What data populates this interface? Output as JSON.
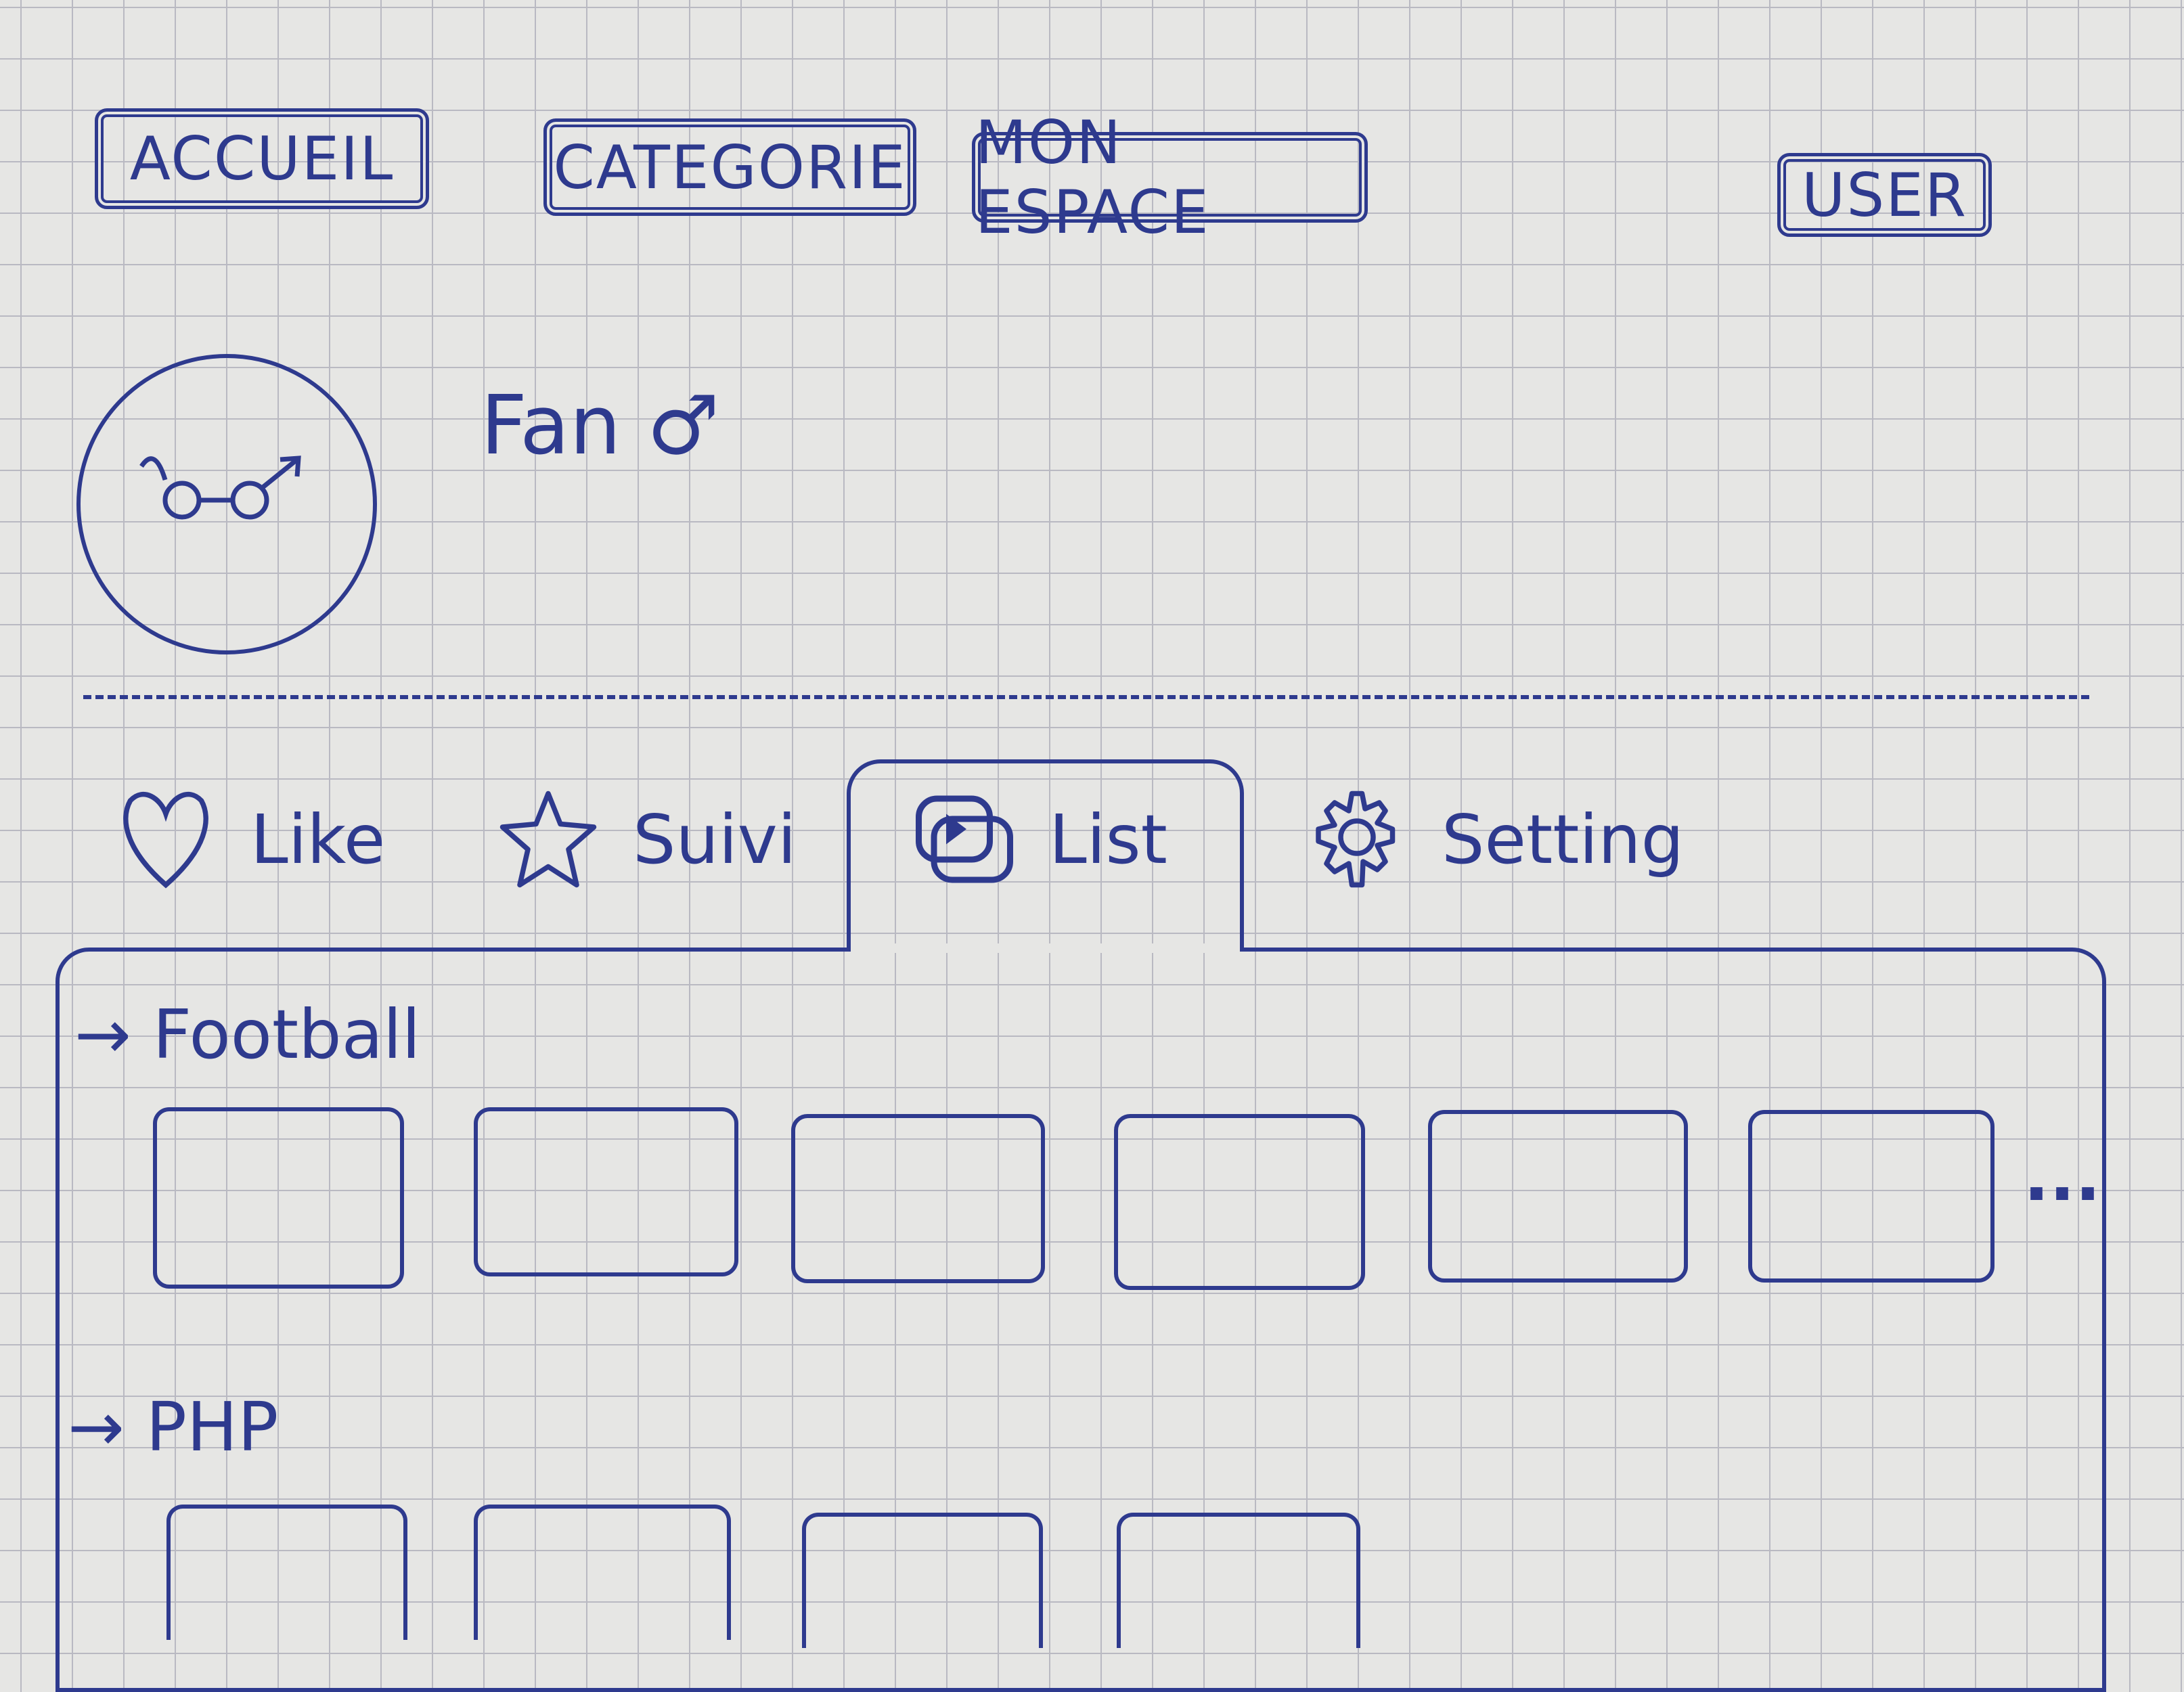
{
  "nav": {
    "items": [
      {
        "label": "ACCUEIL"
      },
      {
        "label": "CATEGORIE"
      },
      {
        "label": "MON ESPACE"
      }
    ],
    "user": "USER"
  },
  "profile": {
    "name": "Fan ♂"
  },
  "tabs": [
    {
      "label": "Like",
      "icon": "heart-icon"
    },
    {
      "label": "Suivi",
      "icon": "star-icon"
    },
    {
      "label": "List",
      "icon": "video-playlist-icon",
      "active": true
    },
    {
      "label": "Setting",
      "icon": "gear-icon"
    }
  ],
  "sections": [
    {
      "title": "→ Football",
      "cards": 6,
      "more": "..."
    },
    {
      "title": "→ PHP",
      "cards": 4
    }
  ],
  "colors": {
    "ink": "#2e3a8e",
    "paper": "#e6e6e4"
  }
}
